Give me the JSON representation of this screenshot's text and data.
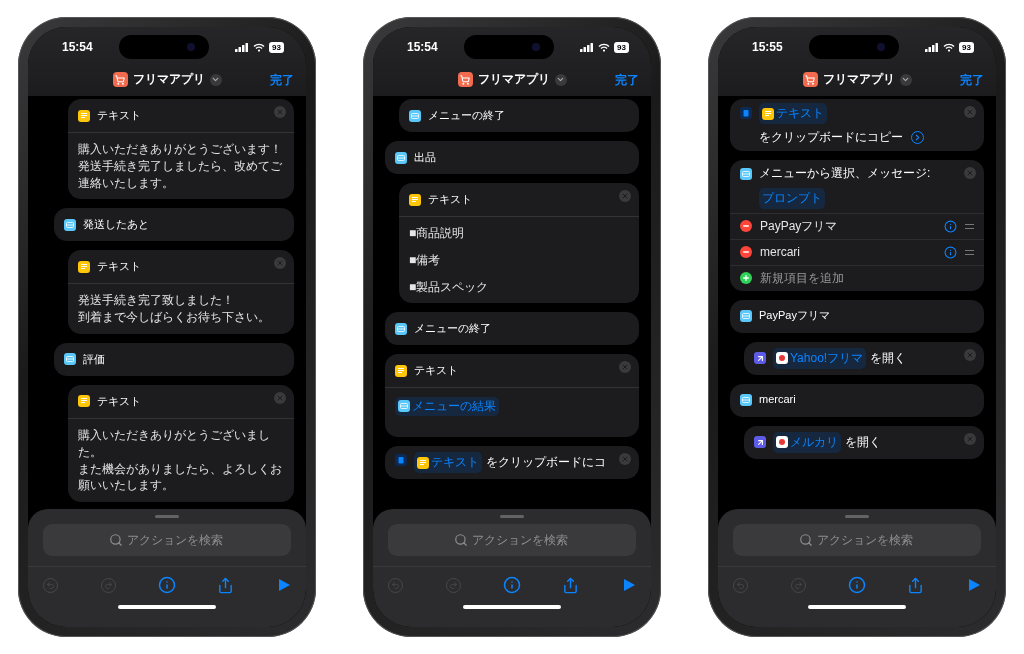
{
  "phones": [
    {
      "status_bar": {
        "time": "15:54",
        "battery": "93"
      },
      "header": {
        "title": "フリマアプリ",
        "done": "完了"
      },
      "blocks": [
        {
          "kind": "continuation",
          "children": [
            {
              "kind": "continuation",
              "children": [
                {
                  "kind": "text",
                  "title": "テキスト",
                  "lines": [
                    "購入いただきありがとうございます！",
                    "発送手続き完了しましたら、改めてご連絡いたします。"
                  ]
                }
              ]
            },
            {
              "kind": "case",
              "label": "発送したあと",
              "children": [
                {
                  "kind": "text",
                  "title": "テキスト",
                  "lines": [
                    "発送手続き完了致しました！",
                    "到着まで今しばらくお待ち下さい。"
                  ]
                }
              ]
            },
            {
              "kind": "case",
              "label": "評価",
              "children": [
                {
                  "kind": "text",
                  "title": "テキスト",
                  "lines": [
                    "購入いただきありがとうございました。",
                    "また機会がありましたら、よろしくお願いいたします。"
                  ]
                }
              ]
            }
          ]
        }
      ],
      "search": {
        "placeholder": "アクションを検索"
      },
      "toolbar": [
        {
          "kind": "undo",
          "disabled": true
        },
        {
          "kind": "redo",
          "disabled": true
        },
        {
          "kind": "info",
          "disabled": false
        },
        {
          "kind": "share",
          "disabled": false
        },
        {
          "kind": "run",
          "disabled": false
        }
      ]
    },
    {
      "status_bar": {
        "time": "15:54",
        "battery": "93"
      },
      "header": {
        "title": "フリマアプリ",
        "done": "完了"
      },
      "blocks": [
        {
          "kind": "continuation",
          "children": [
            {
              "kind": "menu_end",
              "label": "メニューの終了"
            }
          ]
        },
        {
          "kind": "case",
          "label": "出品",
          "children": [
            {
              "kind": "text",
              "title": "テキスト",
              "items": [
                "■商品説明",
                "■備考",
                "■製品スペック"
              ]
            }
          ]
        },
        {
          "kind": "menu_end",
          "label": "メニューの終了"
        },
        {
          "kind": "text",
          "title": "テキスト",
          "token": "メニューの結果"
        },
        {
          "kind": "clipboard",
          "token": "テキスト",
          "text": "をクリップボードにコ",
          "expand": false
        }
      ],
      "search": {
        "placeholder": "アクションを検索"
      },
      "toolbar": [
        {
          "kind": "undo",
          "disabled": true
        },
        {
          "kind": "redo",
          "disabled": true
        },
        {
          "kind": "info",
          "disabled": false
        },
        {
          "kind": "share",
          "disabled": false
        },
        {
          "kind": "run",
          "disabled": false
        }
      ]
    },
    {
      "status_bar": {
        "time": "15:55",
        "battery": "93"
      },
      "header": {
        "title": "フリマアプリ",
        "done": "完了"
      },
      "blocks": [
        {
          "kind": "clipboard",
          "token": "テキスト",
          "text": "をクリップボードにコピー",
          "expand": true
        },
        {
          "kind": "choose_menu",
          "text": "メニューから選択、メッセージ:",
          "token": "プロンプト",
          "options": [
            {
              "label": "PayPayフリマ"
            },
            {
              "label": "mercari"
            }
          ],
          "add_label": "新規項目を追加"
        },
        {
          "kind": "case",
          "label": "PayPayフリマ",
          "children": [
            {
              "kind": "open_app",
              "app": "Yahoo!フリマ",
              "text": "を開く"
            }
          ]
        },
        {
          "kind": "case",
          "label": "mercari",
          "children": [
            {
              "kind": "open_app",
              "app": "メルカリ",
              "text": "を開く"
            }
          ]
        }
      ],
      "search": {
        "placeholder": "アクションを検索"
      },
      "toolbar": [
        {
          "kind": "undo",
          "disabled": true
        },
        {
          "kind": "redo",
          "disabled": true
        },
        {
          "kind": "info",
          "disabled": false
        },
        {
          "kind": "share",
          "disabled": false
        },
        {
          "kind": "run",
          "disabled": false
        }
      ]
    }
  ]
}
